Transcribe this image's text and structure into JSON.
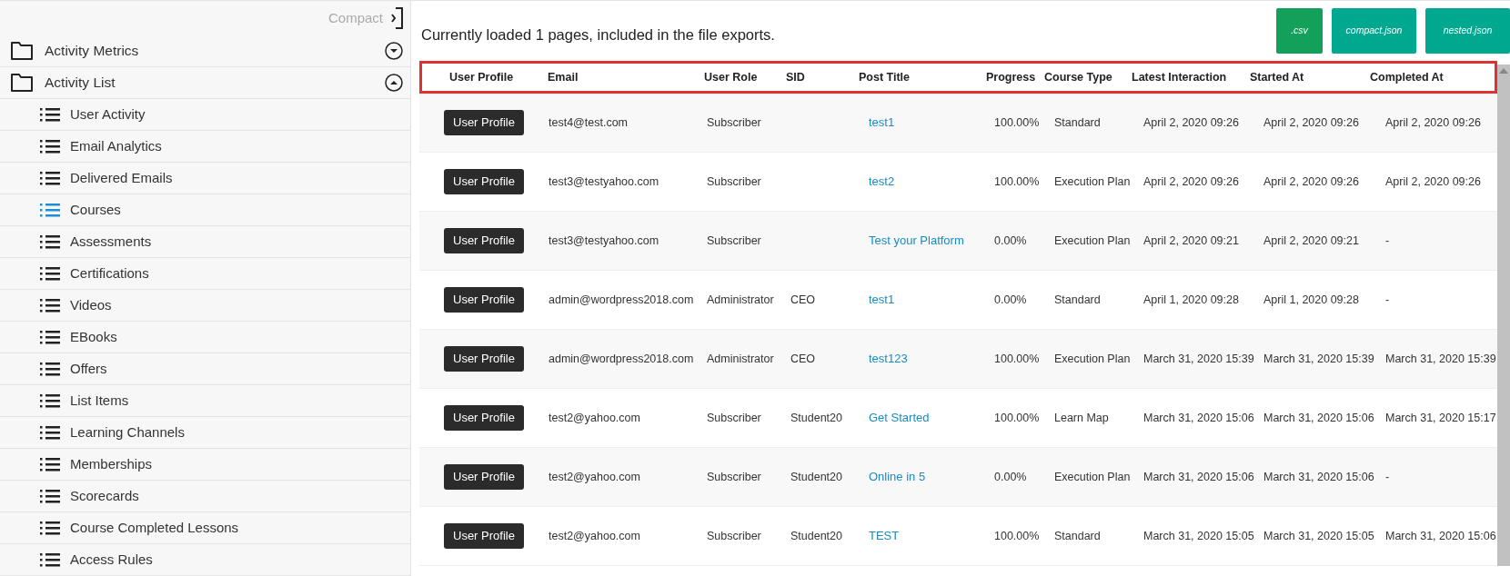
{
  "sidebar": {
    "compact_toggle": "Compact",
    "groups": [
      {
        "label": "Activity Metrics",
        "expanded": false
      },
      {
        "label": "Activity List",
        "expanded": true,
        "children": [
          {
            "label": "User Activity",
            "selected": false
          },
          {
            "label": "Email Analytics",
            "selected": false
          },
          {
            "label": "Delivered Emails",
            "selected": false
          },
          {
            "label": "Courses",
            "selected": true
          },
          {
            "label": "Assessments",
            "selected": false
          },
          {
            "label": "Certifications",
            "selected": false
          },
          {
            "label": "Videos",
            "selected": false
          },
          {
            "label": "EBooks",
            "selected": false
          },
          {
            "label": "Offers",
            "selected": false
          },
          {
            "label": "List Items",
            "selected": false
          },
          {
            "label": "Learning Channels",
            "selected": false
          },
          {
            "label": "Memberships",
            "selected": false
          },
          {
            "label": "Scorecards",
            "selected": false
          },
          {
            "label": "Course Completed Lessons",
            "selected": false
          },
          {
            "label": "Access Rules",
            "selected": false
          }
        ]
      }
    ]
  },
  "main": {
    "summary": "Currently loaded 1 pages, included in the file exports.",
    "export_buttons": [
      {
        "label": ".csv",
        "color": "#13a05a"
      },
      {
        "label": "compact.json",
        "color": "#00a88f"
      },
      {
        "label": "nested.json",
        "color": "#00a88f"
      }
    ],
    "table": {
      "columns": [
        "User Profile",
        "Email",
        "User Role",
        "SID",
        "Post Title",
        "Progress",
        "Course Type",
        "Latest Interaction",
        "Started At",
        "Completed At"
      ],
      "rows": [
        {
          "button": "User Profile",
          "email": "test4@test.com",
          "role": "Subscriber",
          "post_title": "test1",
          "progress": "100.00%",
          "course_type": "Standard",
          "latest": "April 2, 2020 09:26",
          "started": "April 2, 2020 09:26",
          "completed": "April 2, 2020 09:26"
        },
        {
          "button": "User Profile",
          "email": "test3@testyahoo.com",
          "role": "Subscriber",
          "post_title": "test2",
          "progress": "100.00%",
          "course_type": "Execution Plan",
          "latest": "April 2, 2020 09:26",
          "started": "April 2, 2020 09:26",
          "completed": "April 2, 2020 09:26"
        },
        {
          "button": "User Profile",
          "email": "test3@testyahoo.com",
          "role": "Subscriber",
          "post_title": "Test your Platform",
          "progress": "0.00%",
          "course_type": "Execution Plan",
          "latest": "April 2, 2020 09:21",
          "started": "April 2, 2020 09:21",
          "completed": "-"
        },
        {
          "button": "User Profile",
          "email": "admin@wordpress2018.com",
          "role": "Administrator",
          "sid": "CEO",
          "post_title": "test1",
          "progress": "0.00%",
          "course_type": "Standard",
          "latest": "April 1, 2020 09:28",
          "started": "April 1, 2020 09:28",
          "completed": "-"
        },
        {
          "button": "User Profile",
          "email": "admin@wordpress2018.com",
          "role": "Administrator",
          "sid": "CEO",
          "post_title": "test123",
          "progress": "100.00%",
          "course_type": "Execution Plan",
          "latest": "March 31, 2020 15:39",
          "started": "March 31, 2020 15:39",
          "completed": "March 31, 2020 15:39"
        },
        {
          "button": "User Profile",
          "email": "test2@yahoo.com",
          "role": "Subscriber",
          "sid": "Student20",
          "post_title": "Get Started",
          "progress": "100.00%",
          "course_type": "Learn Map",
          "latest": "March 31, 2020 15:06",
          "started": "March 31, 2020 15:06",
          "completed": "March 31, 2020 15:17"
        },
        {
          "button": "User Profile",
          "email": "test2@yahoo.com",
          "role": "Subscriber",
          "sid": "Student20",
          "post_title": "Online in 5",
          "progress": "0.00%",
          "course_type": "Execution Plan",
          "latest": "March 31, 2020 15:06",
          "started": "March 31, 2020 15:06",
          "completed": "-"
        },
        {
          "button": "User Profile",
          "email": "test2@yahoo.com",
          "role": "Subscriber",
          "sid": "Student20",
          "post_title": "TEST",
          "progress": "100.00%",
          "course_type": "Standard",
          "latest": "March 31, 2020 15:05",
          "started": "March 31, 2020 15:05",
          "completed": "March 31, 2020 15:06"
        }
      ]
    }
  }
}
